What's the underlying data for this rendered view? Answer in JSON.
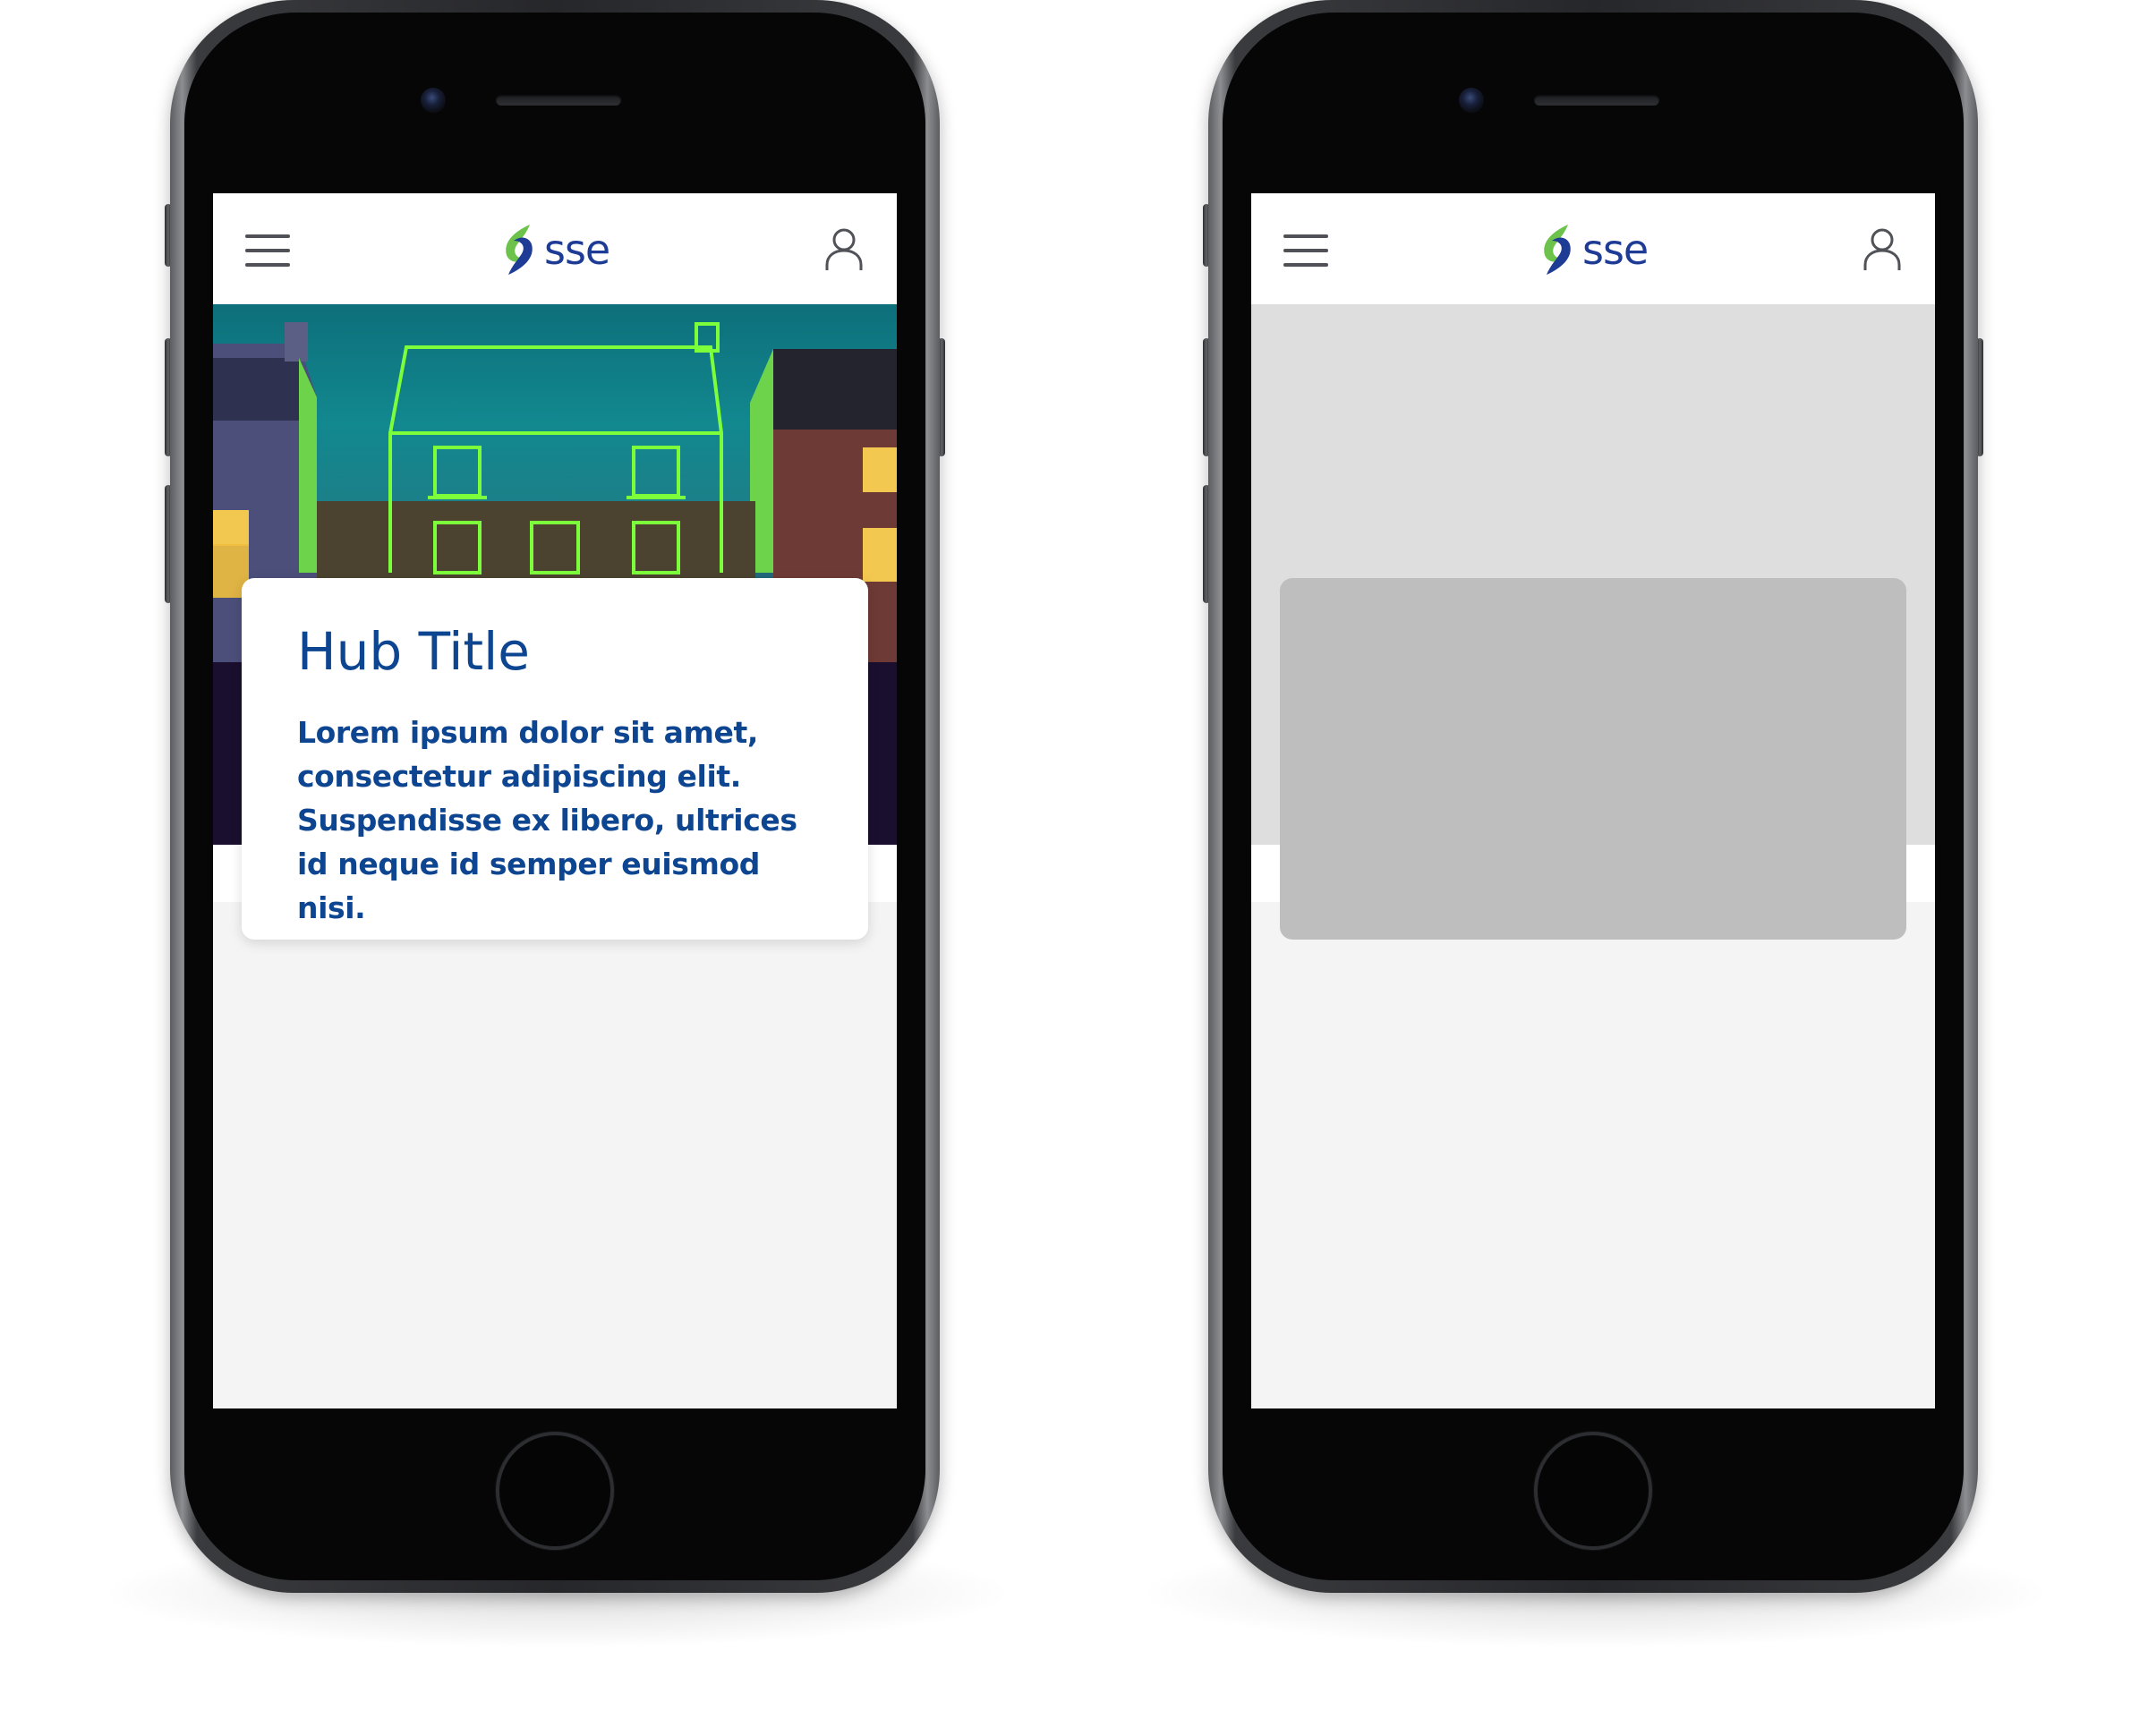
{
  "colors": {
    "brand_blue": "#0d4591",
    "logo_blue": "#1e3c96",
    "logo_green": "#6cc24a",
    "placeholder_light": "#dedede",
    "placeholder_dark": "#bebebe",
    "content_bg": "#f4f4f4"
  },
  "header": {
    "logo_text": "sse",
    "menu_icon": "hamburger-menu-icon",
    "account_icon": "user-account-icon"
  },
  "hub_card": {
    "title": "Hub Title",
    "description": "Lorem ipsum dolor sit amet, consectetur adipiscing elit. Suspendisse ex libero, ultrices id neque id semper euismod nisi."
  },
  "phones": [
    {
      "variant": "populated",
      "hero": "neon-outline-house-image"
    },
    {
      "variant": "wireframe-placeholder",
      "hero": "grey-placeholder"
    }
  ]
}
